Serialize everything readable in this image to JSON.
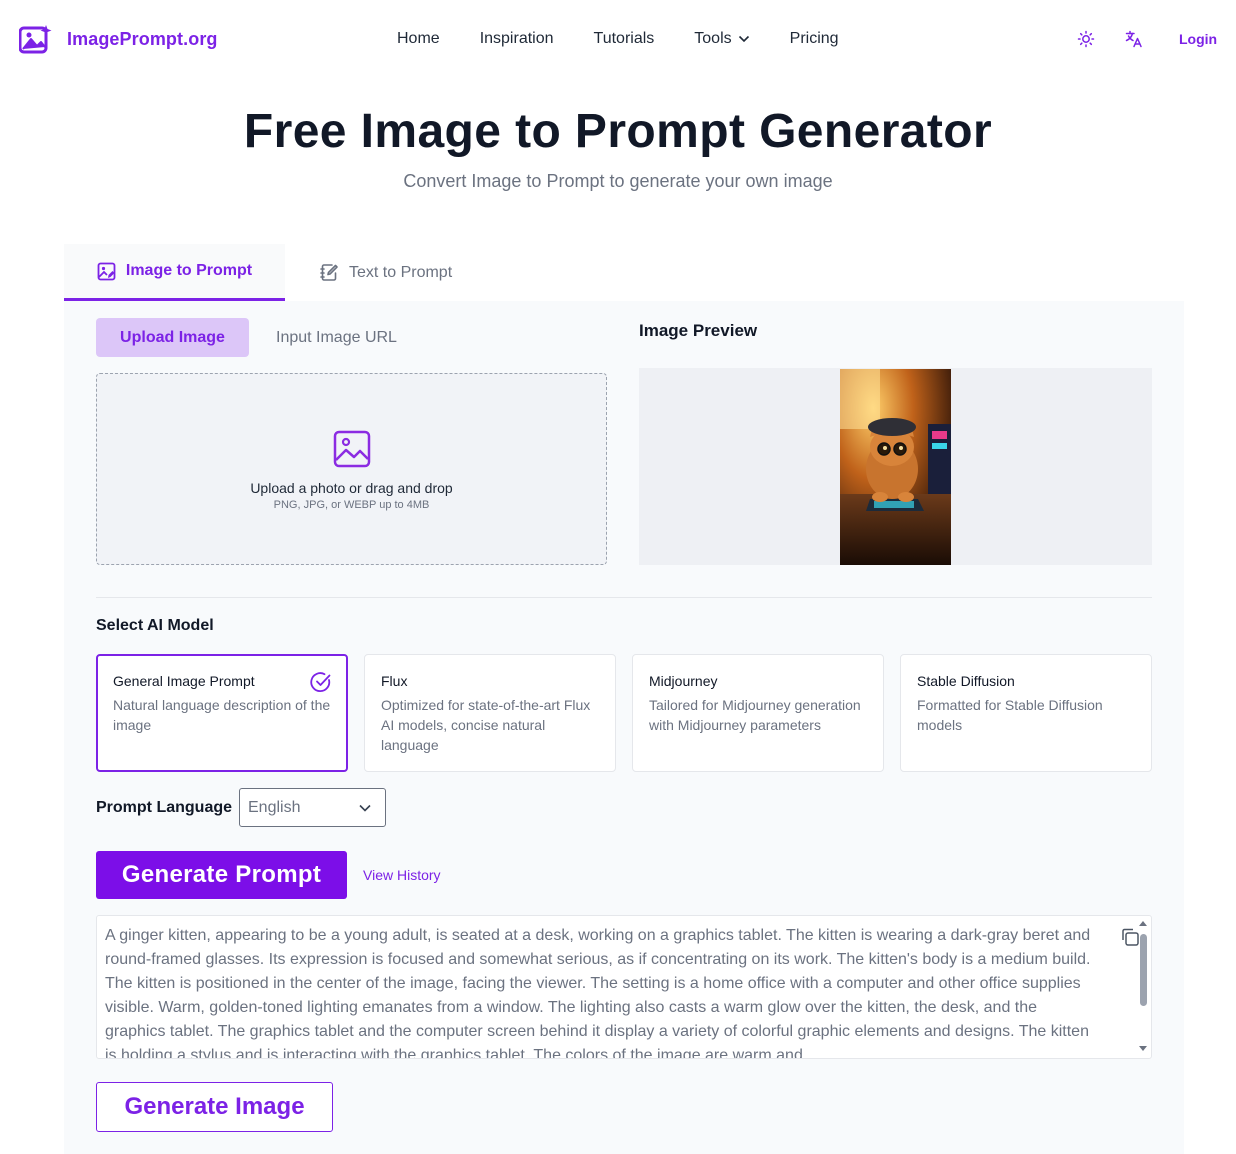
{
  "header": {
    "logo_text": "ImagePrompt.org",
    "nav": [
      {
        "label": "Home"
      },
      {
        "label": "Inspiration"
      },
      {
        "label": "Tutorials"
      },
      {
        "label": "Tools"
      },
      {
        "label": "Pricing"
      }
    ],
    "login_label": "Login",
    "theme_icon": "sun-icon",
    "language_icon": "translate-icon"
  },
  "hero": {
    "title": "Free Image to Prompt Generator",
    "subtitle": "Convert Image to Prompt to generate your own image"
  },
  "main_tabs": [
    {
      "label": "Image to Prompt",
      "active": true
    },
    {
      "label": "Text to Prompt",
      "active": false
    }
  ],
  "upload": {
    "tabs": [
      {
        "label": "Upload Image",
        "active": true
      },
      {
        "label": "Input Image URL",
        "active": false
      }
    ],
    "dropzone_title": "Upload a photo or drag and drop",
    "dropzone_hint": "PNG, JPG, or WEBP up to 4MB"
  },
  "preview": {
    "label": "Image Preview"
  },
  "models": {
    "label": "Select AI Model",
    "items": [
      {
        "name": "General Image Prompt",
        "desc": "Natural language description of the image",
        "selected": true
      },
      {
        "name": "Flux",
        "desc": "Optimized for state-of-the-art Flux AI models, concise natural language",
        "selected": false
      },
      {
        "name": "Midjourney",
        "desc": "Tailored for Midjourney generation with Midjourney parameters",
        "selected": false
      },
      {
        "name": "Stable Diffusion",
        "desc": "Formatted for Stable Diffusion models",
        "selected": false
      }
    ]
  },
  "language": {
    "label": "Prompt Language",
    "selected": "English"
  },
  "actions": {
    "generate_prompt": "Generate Prompt",
    "view_history": "View History",
    "generate_image": "Generate Image"
  },
  "output": {
    "text": "A ginger kitten, appearing to be a young adult, is seated at a desk, working on a graphics tablet.  The kitten is wearing a dark-gray beret and round-framed glasses. Its expression is focused and somewhat serious, as if concentrating on its work. The kitten's body is a medium build.  The kitten is positioned in the center of the image, facing the viewer. The setting is a home office with a computer and other office supplies visible.  Warm, golden-toned lighting emanates from a window.  The lighting also casts a warm glow over the kitten, the desk, and the graphics tablet. The graphics tablet and the computer screen behind it display a variety of colorful graphic elements and designs.  The kitten is holding a stylus and is interacting with the graphics tablet.  The colors of the image are warm and"
  },
  "colors": {
    "accent": "#7c22e6",
    "button": "#7c0ee8",
    "subtab_active_bg": "#dcc6f8"
  }
}
